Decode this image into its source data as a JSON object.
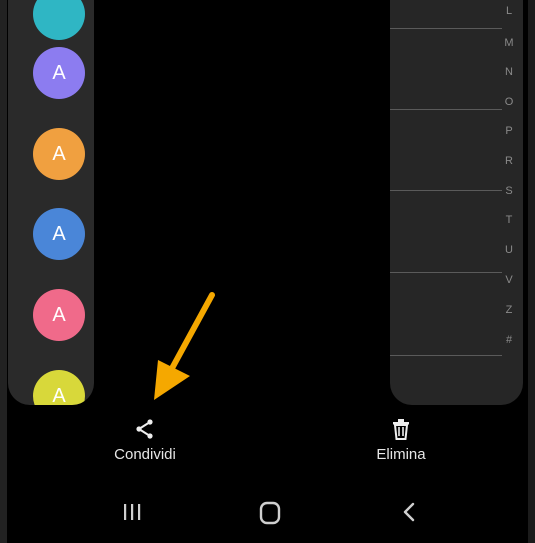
{
  "avatars": [
    {
      "letter": "A",
      "color": "#8c7cf0"
    },
    {
      "letter": "A",
      "color": "#f0a040"
    },
    {
      "letter": "A",
      "color": "#4a86d8"
    },
    {
      "letter": "A",
      "color": "#f06a8a"
    },
    {
      "letter": "A",
      "color": "#d8d83a"
    }
  ],
  "index_letters": [
    "L",
    "M",
    "N",
    "O",
    "P",
    "R",
    "S",
    "T",
    "U",
    "V",
    "Z",
    "#"
  ],
  "actions": {
    "share_label": "Condividi",
    "delete_label": "Elimina"
  },
  "annotation": {
    "arrow_color": "#f5a800"
  }
}
